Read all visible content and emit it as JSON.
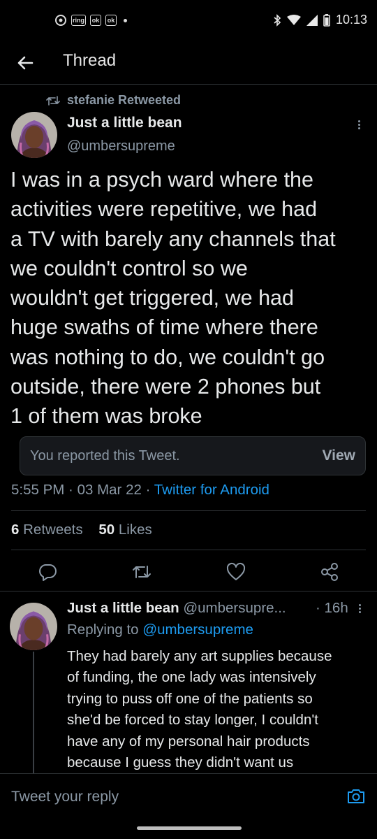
{
  "status_bar": {
    "notif_icons": [
      "ring",
      "ok",
      "ok"
    ],
    "time": "10:13"
  },
  "header": {
    "title": "Thread"
  },
  "tweet": {
    "retweeted_by": "stefanie Retweeted",
    "author_name": "Just a little bean",
    "author_handle": "@umbersupreme",
    "text_lines": [
      "I was in a psych ward where the",
      "activities were repetitive, we had",
      "a TV with barely any channels that",
      "we couldn't control so we",
      "wouldn't get triggered, we had",
      "huge swaths of time where there",
      "was nothing to do, we couldn't go",
      "outside, there were 2 phones but",
      "1 of them was broke"
    ],
    "reported_text": "You reported this Tweet.",
    "reported_action": "View",
    "time": "5:55 PM",
    "date": "03 Mar 22",
    "source": "Twitter for Android",
    "retweets_count": "6",
    "retweets_label": "Retweets",
    "likes_count": "50",
    "likes_label": "Likes"
  },
  "reply": {
    "author_name": "Just a little bean",
    "author_handle": "@umbersupre...",
    "time": "16h",
    "replying_label": "Replying to",
    "replying_handle": "@umbersupreme",
    "text_lines": [
      "They had barely any art supplies because",
      "of funding, the one lady was intensively",
      "trying to puss off one of the patients so",
      "she'd be forced to stay longer, I couldn't",
      "have any of my personal hair products",
      "because I guess they didn't want us"
    ]
  },
  "composer": {
    "placeholder": "Tweet your reply"
  },
  "colors": {
    "link": "#1d9bf0",
    "muted": "#8b98a5",
    "background": "#000000"
  }
}
